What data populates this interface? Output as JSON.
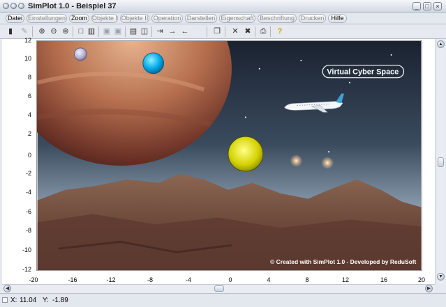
{
  "window": {
    "title": "SimPlot 1.0 - Beispiel 37"
  },
  "menu": [
    {
      "label": "Datei",
      "enabled": true
    },
    {
      "label": "Einstellungen",
      "enabled": false
    },
    {
      "label": "Zoom",
      "enabled": true
    },
    {
      "label": "Objekte I",
      "enabled": false
    },
    {
      "label": "Objekte II",
      "enabled": false
    },
    {
      "label": "Operation",
      "enabled": false
    },
    {
      "label": "Darstellen",
      "enabled": false
    },
    {
      "label": "Eigenschaft",
      "enabled": false
    },
    {
      "label": "Beschriftung",
      "enabled": false
    },
    {
      "label": "Drucken",
      "enabled": false
    },
    {
      "label": "Hilfe",
      "enabled": true
    }
  ],
  "toolbar": {
    "icons": [
      "device-icon",
      "draw-icon",
      "zoom-in-icon",
      "zoom-out-icon",
      "zoom-fit-icon",
      "square-icon",
      "grid-icon",
      "frame-icon",
      "frame-alt-icon",
      "table-icon",
      "layers-icon",
      "move-icon",
      "arrow-right-icon",
      "arrow-left-icon",
      "copy-icon",
      "cross-icon",
      "cross-alt-icon",
      "print-icon",
      "help-icon"
    ]
  },
  "plot": {
    "y_ticks": [
      "12",
      "10",
      "8",
      "6",
      "4",
      "2",
      "0",
      "-2",
      "-4",
      "-6",
      "-8",
      "-10",
      "-12"
    ],
    "x_ticks": [
      "-20",
      "-16",
      "-12",
      "-8",
      "-4",
      "0",
      "4",
      "8",
      "12",
      "16",
      "20"
    ],
    "scene_label": "Virtual Cyber Space",
    "credit": "© Created with SimPlot 1.0 - Developed by ReduSoft",
    "colors": {
      "cyan_circle": "#00a8e8",
      "yellow_circle": "#d4d200",
      "lilac_circle": "#b8b4d0"
    }
  },
  "status": {
    "x_label": "X:",
    "x_value": "11.04",
    "y_label": "Y:",
    "y_value": "-1.89"
  }
}
